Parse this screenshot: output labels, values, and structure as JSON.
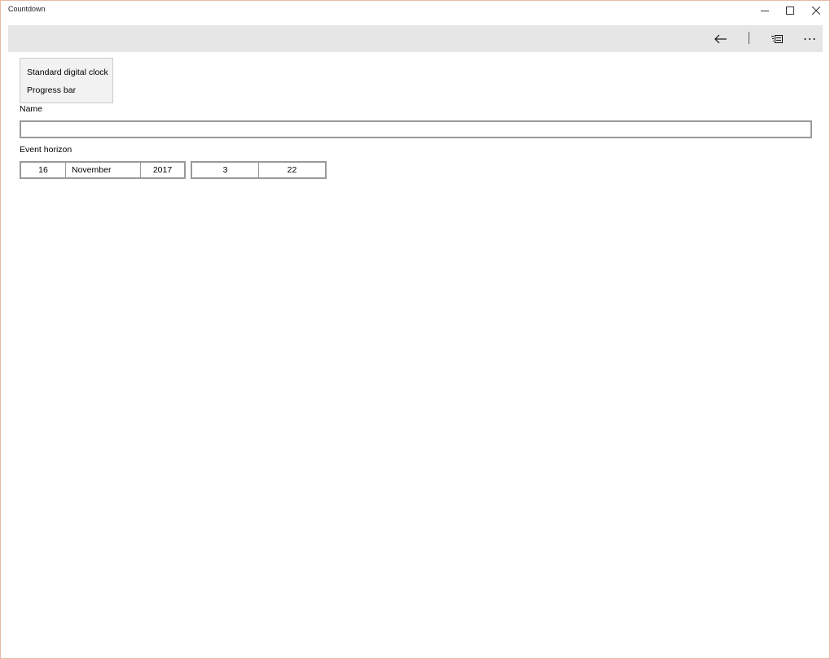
{
  "window": {
    "title": "Countdown"
  },
  "caption": {
    "minimize_icon": "minimize-icon",
    "maximize_icon": "maximize-icon",
    "close_icon": "close-icon"
  },
  "commandbar": {
    "back_icon": "back-arrow-icon",
    "view_icon": "list-view-icon",
    "more_icon": "more-ellipsis-icon",
    "background": "#e6e6e6"
  },
  "clock_style": {
    "options": [
      "Standard digital clock",
      "Progress bar"
    ]
  },
  "form": {
    "name_label": "Name",
    "name_value": "",
    "horizon_label": "Event horizon",
    "date": {
      "day": "16",
      "month": "November",
      "year": "2017"
    },
    "time": {
      "hour": "3",
      "minute": "22"
    }
  }
}
